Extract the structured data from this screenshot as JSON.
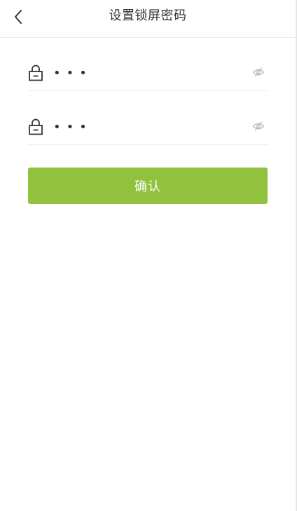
{
  "header": {
    "title": "设置锁屏密码",
    "back_icon": "chevron-left-icon"
  },
  "fields": [
    {
      "value": "•••",
      "lock_icon": "lock-icon",
      "toggle_icon": "eye-hidden-icon"
    },
    {
      "value": "•••",
      "lock_icon": "lock-icon",
      "toggle_icon": "eye-hidden-icon"
    }
  ],
  "confirm": {
    "label": "确认"
  },
  "colors": {
    "accent": "#92c13e",
    "text": "#333333",
    "icon_muted": "#bbbbbb",
    "divider": "#ebebeb"
  }
}
